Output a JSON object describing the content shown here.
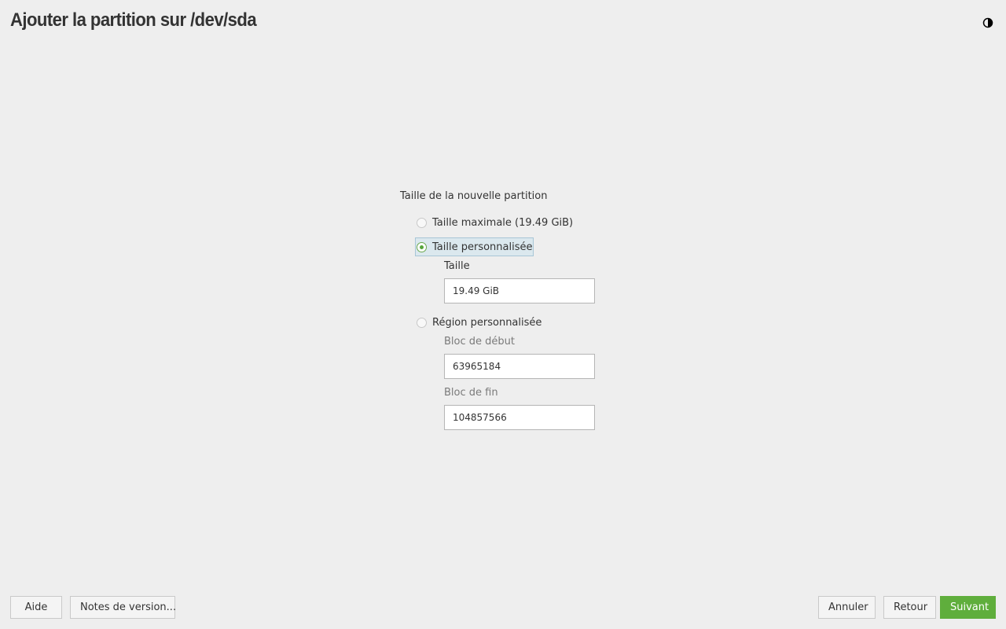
{
  "header": {
    "title": "Ajouter la partition sur /dev/sda",
    "theme_toggle_icon": "half-moon-icon"
  },
  "size_group": {
    "title": "Taille de la nouvelle partition",
    "options": {
      "max": {
        "label": "Taille maximale (19.49 GiB)",
        "checked": false
      },
      "custom": {
        "label": "Taille personnalisée",
        "checked": true,
        "size_label": "Taille",
        "size_value": "19.49 GiB"
      },
      "region": {
        "label": "Région personnalisée",
        "checked": false,
        "start_label": "Bloc de début",
        "start_value": "63965184",
        "end_label": "Bloc de fin",
        "end_value": "104857566"
      }
    }
  },
  "footer": {
    "help": "Aide",
    "release_notes": "Notes de version...",
    "abort": "Annuler",
    "back": "Retour",
    "next": "Suivant"
  },
  "colors": {
    "background": "#eeeeee",
    "accent": "#5fae3c",
    "focus_highlight": "#dbe8ee"
  }
}
